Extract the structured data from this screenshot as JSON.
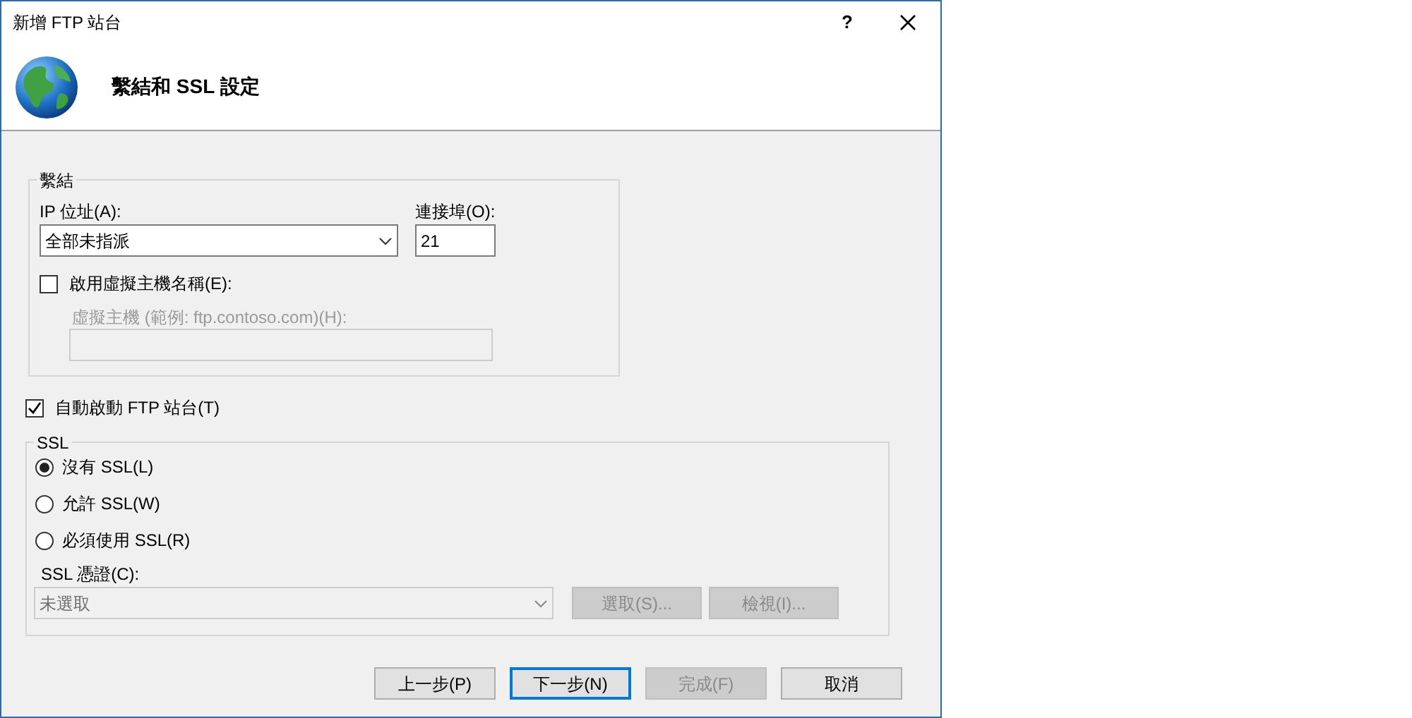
{
  "window": {
    "title": "新增 FTP 站台",
    "help": "?"
  },
  "header": {
    "title": "繫結和 SSL 設定"
  },
  "binding": {
    "legend": "繫結",
    "ip_label": "IP 位址(A):",
    "ip_value": "全部未指派",
    "port_label": "連接埠(O):",
    "port_value": "21",
    "virtual_host": {
      "label": "啟用虛擬主機名稱(E):",
      "checked": false
    },
    "host_label": "虛擬主機 (範例: ftp.contoso.com)(H):",
    "host_disabled": true
  },
  "auto_start": {
    "label": "自動啟動 FTP 站台(T)",
    "checked": true
  },
  "ssl": {
    "legend": "SSL",
    "options": [
      {
        "label": "沒有 SSL(L)",
        "selected": true
      },
      {
        "label": "允許 SSL(W)",
        "selected": false
      },
      {
        "label": "必須使用 SSL(R)",
        "selected": false
      }
    ],
    "cert_label": "SSL 憑證(C):",
    "cert_value": "未選取",
    "cert_disabled": true,
    "buttons": [
      {
        "label": "選取(S)...",
        "disabled": true
      },
      {
        "label": "檢視(I)...",
        "disabled": true
      }
    ]
  },
  "buttons": [
    {
      "label": "上一步(P)",
      "disabled": false,
      "default": false
    },
    {
      "label": "下一步(N)",
      "disabled": false,
      "default": true
    },
    {
      "label": "完成(F)",
      "disabled": true,
      "default": false
    },
    {
      "label": "取消",
      "disabled": false,
      "default": false
    }
  ]
}
